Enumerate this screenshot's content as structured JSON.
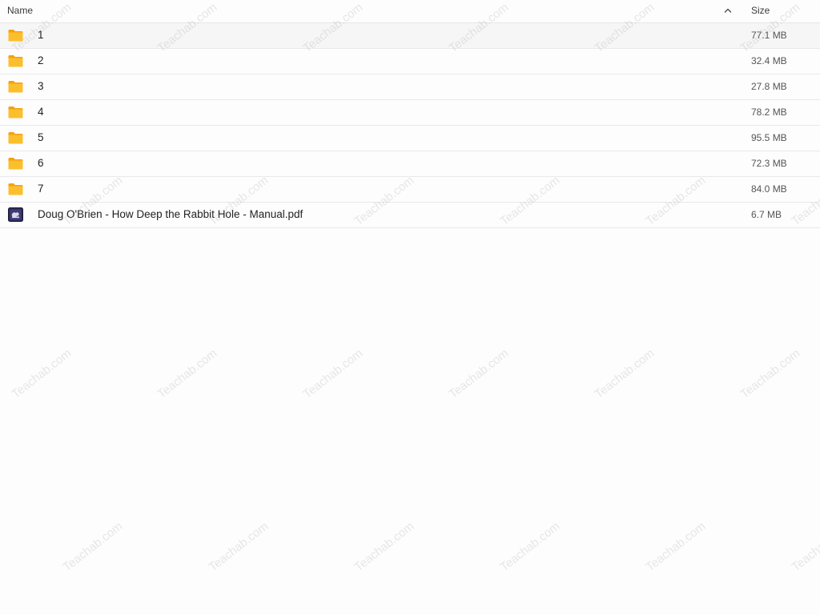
{
  "header": {
    "name_label": "Name",
    "size_label": "Size",
    "sort_icon": "chevron-up-icon"
  },
  "files": [
    {
      "name": "1",
      "size": "77.1 MB",
      "type": "folder",
      "icon": "folder-icon"
    },
    {
      "name": "2",
      "size": "32.4 MB",
      "type": "folder",
      "icon": "folder-icon"
    },
    {
      "name": "3",
      "size": "27.8 MB",
      "type": "folder",
      "icon": "folder-icon"
    },
    {
      "name": "4",
      "size": "78.2 MB",
      "type": "folder",
      "icon": "folder-icon"
    },
    {
      "name": "5",
      "size": "95.5 MB",
      "type": "folder",
      "icon": "folder-icon"
    },
    {
      "name": "6",
      "size": "72.3 MB",
      "type": "folder",
      "icon": "folder-icon"
    },
    {
      "name": "7",
      "size": "84.0 MB",
      "type": "folder",
      "icon": "folder-icon"
    },
    {
      "name": "Doug O'Brien - How Deep the Rabbit Hole - Manual.pdf",
      "size": "6.7 MB",
      "type": "pdf",
      "icon": "pdf-thumbnail-icon"
    }
  ],
  "watermark": {
    "text": "Teachab.com"
  },
  "colors": {
    "folder": "#F9B320",
    "folder_tab": "#F4A20F",
    "row_highlight": "#f6f6f6"
  }
}
